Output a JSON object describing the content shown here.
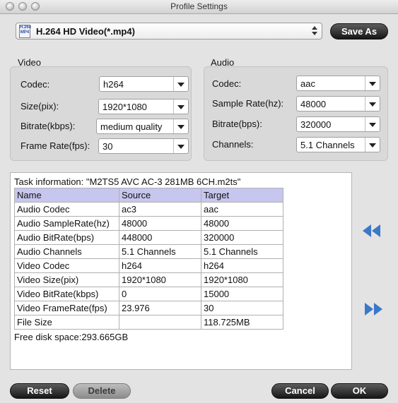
{
  "window": {
    "title": "Profile Settings"
  },
  "profile": {
    "icon_text": "H.264 MP4",
    "selected": "H.264 HD Video(*.mp4)"
  },
  "buttons": {
    "save_as": "Save As",
    "reset": "Reset",
    "delete": "Delete",
    "cancel": "Cancel",
    "ok": "OK"
  },
  "video": {
    "title": "Video",
    "codec_label": "Codec:",
    "codec_value": "h264",
    "size_label": "Size(pix):",
    "size_value": "1920*1080",
    "bitrate_label": "Bitrate(kbps):",
    "bitrate_value": "medium quality",
    "framerate_label": "Frame Rate(fps):",
    "framerate_value": "30"
  },
  "audio": {
    "title": "Audio",
    "codec_label": "Codec:",
    "codec_value": "aac",
    "samplerate_label": "Sample Rate(hz):",
    "samplerate_value": "48000",
    "bitrate_label": "Bitrate(bps):",
    "bitrate_value": "320000",
    "channels_label": "Channels:",
    "channels_value": "5.1 Channels"
  },
  "task": {
    "info_line": "Task information: \"M2TS5 AVC AC-3 281MB 6CH.m2ts\"",
    "headers": [
      "Name",
      "Source",
      "Target"
    ],
    "rows": [
      [
        "Audio Codec",
        "ac3",
        "aac"
      ],
      [
        "Audio SampleRate(hz)",
        "48000",
        "48000"
      ],
      [
        "Audio BitRate(bps)",
        "448000",
        "320000"
      ],
      [
        "Audio Channels",
        "5.1 Channels",
        "5.1 Channels"
      ],
      [
        "Video Codec",
        "h264",
        "h264"
      ],
      [
        "Video Size(pix)",
        "1920*1080",
        "1920*1080"
      ],
      [
        "Video BitRate(kbps)",
        "0",
        "15000"
      ],
      [
        "Video FrameRate(fps)",
        "23.976",
        "30"
      ],
      [
        "File Size",
        "",
        "118.725MB"
      ]
    ],
    "free_space": "Free disk space:293.665GB"
  },
  "colors": {
    "accent_arrow": "#3a78c8",
    "table_header": "#c6c6ee"
  },
  "icons": {
    "collapse": "double-left-arrow-icon",
    "expand": "double-right-arrow-icon"
  }
}
